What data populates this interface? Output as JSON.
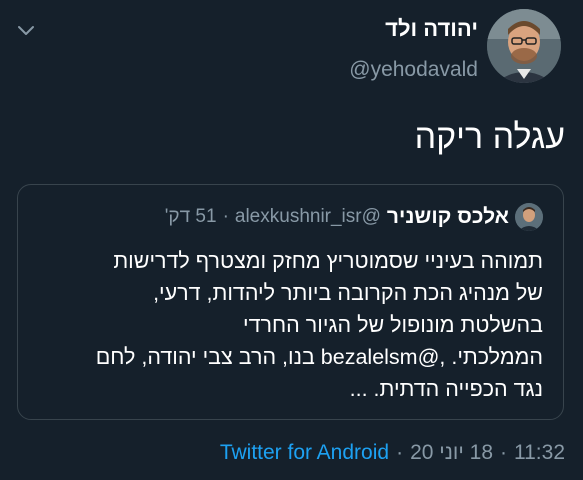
{
  "tweet": {
    "display_name": "יהודה ולד",
    "handle": "@yehodavald",
    "text": "עגלה ריקה",
    "time": "11:32",
    "date": "18 יוני 20",
    "source": "Twitter for Android",
    "separator": "·"
  },
  "quoted_tweet": {
    "display_name": "אלכס קושניר",
    "handle": "@alexkushnir_isr",
    "separator": "·",
    "relative_time": "51 דק'",
    "lines": [
      "תמוהה בעיניי שסמוטריץ מחזק ומצטרף לדרישות",
      "של מנהיג הכת הקרובה ביותר ליהדות, דרעי,",
      "בהשלטת מונופול של הגיור החרדי",
      "נגד הכפייה הדתית. ..."
    ],
    "line4": {
      "before": "הממלכתי. ,",
      "mention": "@bezalelsm",
      "after": " בנו, הרב צבי יהודה, לחם"
    }
  },
  "icons": {
    "menu": "chevron-down-icon"
  },
  "colors": {
    "background": "#15202b",
    "secondary_text": "#8899a6",
    "link": "#1da1f2",
    "border": "#38444d"
  }
}
